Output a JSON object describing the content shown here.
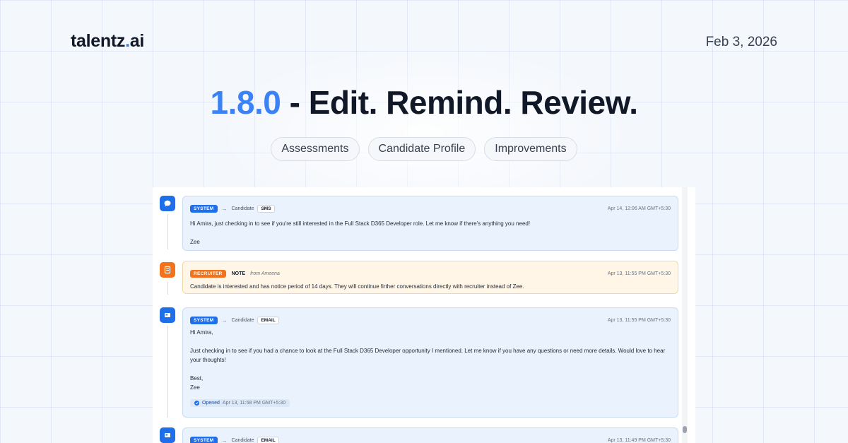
{
  "brand": {
    "logo_part1": "talentz",
    "logo_dot": ".",
    "logo_part2": "ai"
  },
  "date": "Feb 3, 2026",
  "headline": {
    "version": "1.8.0",
    "separator": " - ",
    "title": "Edit. Remind. Review."
  },
  "tags": [
    "Assessments",
    "Candidate Profile",
    "Improvements"
  ],
  "activity": [
    {
      "type": "system",
      "icon": "chat-bubble-icon",
      "badge": "SYSTEM",
      "arrow": "→",
      "recipient": "Candidate",
      "channel": "SMS",
      "timestamp": "Apr 14, 12:06 AM GMT+5:30",
      "lines": [
        "Hi Amira, just checking in to see if you're still interested in the Full Stack D365 Developer role. Let me know if there's anything you need!",
        "",
        "Zee"
      ]
    },
    {
      "type": "note",
      "icon": "note-icon",
      "badge": "RECRUITER",
      "label": "NOTE",
      "from": "from Ameena",
      "timestamp": "Apr 13, 11:55 PM GMT+5:30",
      "lines": [
        "Candidate is interested and has notice period of 14 days. They will continue firther conversations directly with recruiter instead of Zee."
      ]
    },
    {
      "type": "system",
      "icon": "email-icon",
      "badge": "SYSTEM",
      "arrow": "→",
      "recipient": "Candidate",
      "channel": "EMAIL",
      "timestamp": "Apr 13, 11:55 PM GMT+5:30",
      "lines": [
        "Hi Amira,",
        "",
        "Just checking in to see if you had a chance to look at the Full Stack D365 Developer opportunity I mentioned. Let me know if you have any questions or need more details. Would love to hear your thoughts!",
        "",
        "Best,",
        "Zee"
      ],
      "status": {
        "label": "Opened",
        "time": "Apr 13, 11:58 PM GMT+5:30"
      }
    },
    {
      "type": "system",
      "icon": "email-icon",
      "badge": "SYSTEM",
      "arrow": "→",
      "recipient": "Candidate",
      "channel": "EMAIL",
      "timestamp": "Apr 13, 11:49 PM GMT+5:30"
    }
  ],
  "colors": {
    "accent": "#3b82f6",
    "system_badge": "#1f6feb",
    "recruiter_badge": "#f2731b"
  }
}
